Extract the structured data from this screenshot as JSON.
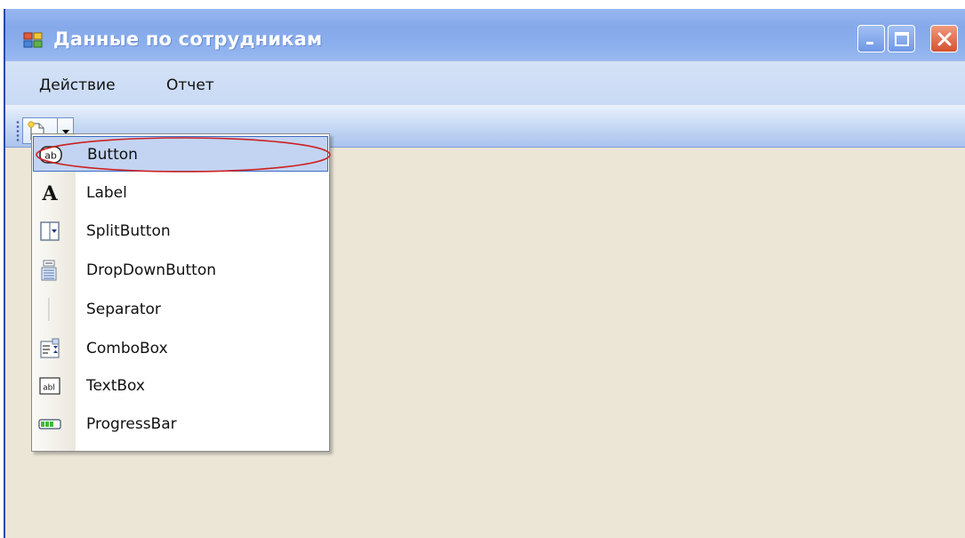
{
  "window": {
    "title": "Данные по сотрудникам"
  },
  "menubar": {
    "items": [
      {
        "label": "Действие"
      },
      {
        "label": "Отчет"
      }
    ]
  },
  "toolbar": {
    "split_button_icon": "new-document-icon",
    "split_button_arrow": "chevron-down-icon"
  },
  "dropdown": {
    "items": [
      {
        "label": "Button",
        "icon": "button-ab-icon",
        "selected": true
      },
      {
        "label": "Label",
        "icon": "label-a-icon"
      },
      {
        "label": "SplitButton",
        "icon": "split-button-icon"
      },
      {
        "label": "DropDownButton",
        "icon": "dropdown-button-icon"
      },
      {
        "label": "Separator",
        "icon": "separator-icon"
      },
      {
        "label": "ComboBox",
        "icon": "combobox-icon"
      },
      {
        "label": "TextBox",
        "icon": "textbox-abl-icon"
      },
      {
        "label": "ProgressBar",
        "icon": "progressbar-icon"
      }
    ]
  },
  "colors": {
    "titlebar": "#8aaeec",
    "menubar": "#ccdcf5",
    "client_area": "#ece6d6",
    "selection": "#c2d4f2",
    "annotation": "#cc2222"
  }
}
